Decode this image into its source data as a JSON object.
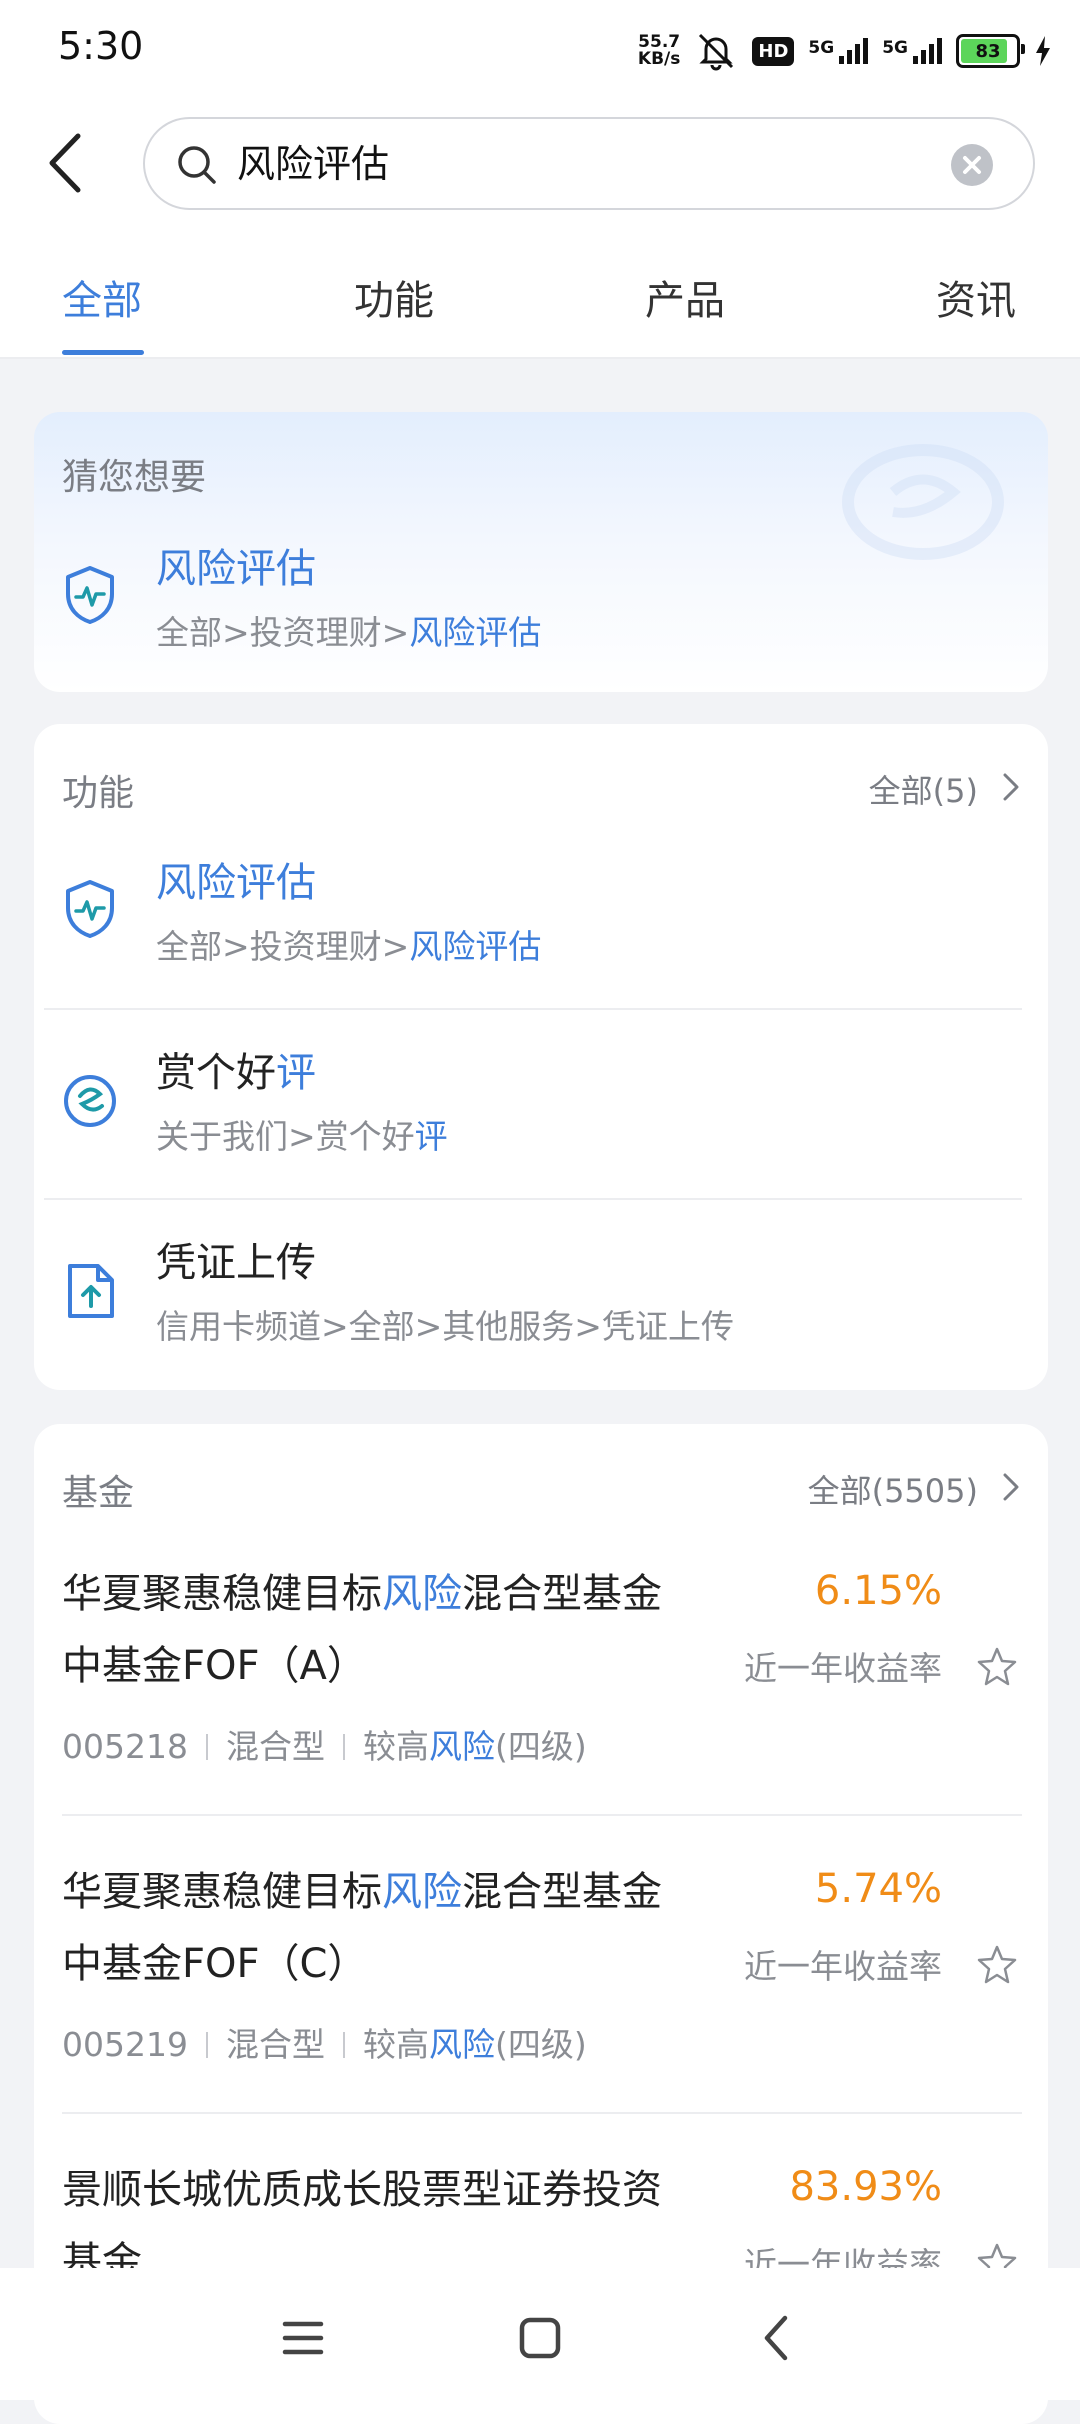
{
  "status_bar": {
    "time": "5:30",
    "net_speed_value": "55.7",
    "net_speed_unit": "KB/s",
    "hd_label": "HD",
    "signal1_label": "5G",
    "signal2_label": "5G",
    "battery": "83"
  },
  "search": {
    "query": "风险评估"
  },
  "tabs": [
    {
      "label": "全部"
    },
    {
      "label": "功能"
    },
    {
      "label": "产品"
    },
    {
      "label": "资讯"
    }
  ],
  "guess": {
    "title": "猜您想要",
    "item": {
      "title": "风险评估",
      "path_prefix": "全部>投资理财>",
      "path_highlight": "风险评估"
    }
  },
  "functions": {
    "title": "功能",
    "more": "全部(5)",
    "items": [
      {
        "title_plain": "",
        "title_highlight": "风险评估",
        "path_plain": "全部>投资理财>",
        "path_highlight": "风险评估"
      },
      {
        "title_plain": "赏个好",
        "title_highlight": "评",
        "path_plain": "关于我们>赏个好",
        "path_highlight": "评"
      },
      {
        "title_plain": "凭证上传",
        "title_highlight": "",
        "path_plain": "信用卡频道>全部>其他服务>凭证上传",
        "path_highlight": ""
      }
    ]
  },
  "funds": {
    "title": "基金",
    "more": "全部(5505)",
    "items": [
      {
        "name_a": "华夏聚惠稳健目标",
        "name_hl": "风险",
        "name_b": "混合型基金中基金FOF（A）",
        "code": "005218",
        "category": "混合型",
        "risk_a": "较高",
        "risk_hl": "风险",
        "risk_b": "(四级)",
        "rate": "6.15%",
        "rate_label": "近一年收益率"
      },
      {
        "name_a": "华夏聚惠稳健目标",
        "name_hl": "风险",
        "name_b": "混合型基金中基金FOF（C）",
        "code": "005219",
        "category": "混合型",
        "risk_a": "较高",
        "risk_hl": "风险",
        "risk_b": "(四级)",
        "rate": "5.74%",
        "rate_label": "近一年收益率"
      },
      {
        "name_a": "景顺长城优质成长股票型证券投资基金",
        "name_hl": "",
        "name_b": "",
        "rate": "83.93%",
        "rate_label": "近一年收益率"
      }
    ]
  },
  "colors": {
    "accent": "#3D7EDB",
    "rate": "#F08C17",
    "icon_teal": "#1E9AA8"
  }
}
